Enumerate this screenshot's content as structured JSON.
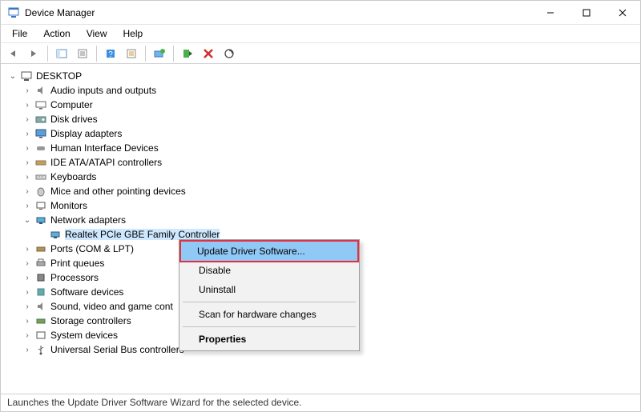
{
  "window": {
    "title": "Device Manager"
  },
  "menubar": {
    "file": "File",
    "action": "Action",
    "view": "View",
    "help": "Help"
  },
  "tree": {
    "root": "DESKTOP",
    "nodes": [
      "Audio inputs and outputs",
      "Computer",
      "Disk drives",
      "Display adapters",
      "Human Interface Devices",
      "IDE ATA/ATAPI controllers",
      "Keyboards",
      "Mice and other pointing devices",
      "Monitors",
      "Network adapters",
      "Ports (COM & LPT)",
      "Print queues",
      "Processors",
      "Software devices",
      "Sound, video and game cont",
      "Storage controllers",
      "System devices",
      "Universal Serial Bus controllers"
    ],
    "network_child": "Realtek PCIe GBE Family Controller"
  },
  "context_menu": {
    "update": "Update Driver Software...",
    "disable": "Disable",
    "uninstall": "Uninstall",
    "scan": "Scan for hardware changes",
    "properties": "Properties"
  },
  "statusbar": {
    "text": "Launches the Update Driver Software Wizard for the selected device."
  }
}
